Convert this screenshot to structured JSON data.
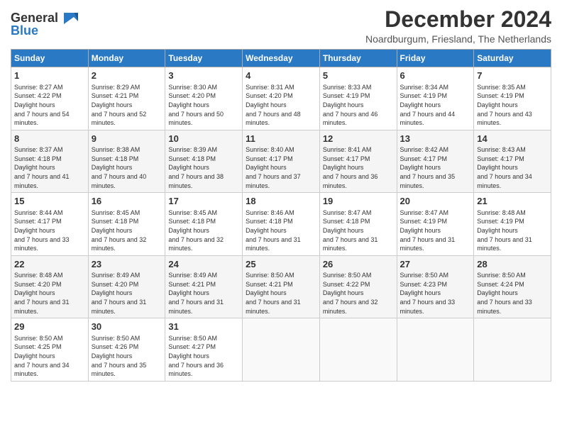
{
  "header": {
    "logo_line1": "General",
    "logo_line2": "Blue",
    "month": "December 2024",
    "location": "Noardburgum, Friesland, The Netherlands"
  },
  "days_of_week": [
    "Sunday",
    "Monday",
    "Tuesday",
    "Wednesday",
    "Thursday",
    "Friday",
    "Saturday"
  ],
  "weeks": [
    [
      {
        "day": "1",
        "sunrise": "8:27 AM",
        "sunset": "4:22 PM",
        "daylight": "7 hours and 54 minutes."
      },
      {
        "day": "2",
        "sunrise": "8:29 AM",
        "sunset": "4:21 PM",
        "daylight": "7 hours and 52 minutes."
      },
      {
        "day": "3",
        "sunrise": "8:30 AM",
        "sunset": "4:20 PM",
        "daylight": "7 hours and 50 minutes."
      },
      {
        "day": "4",
        "sunrise": "8:31 AM",
        "sunset": "4:20 PM",
        "daylight": "7 hours and 48 minutes."
      },
      {
        "day": "5",
        "sunrise": "8:33 AM",
        "sunset": "4:19 PM",
        "daylight": "7 hours and 46 minutes."
      },
      {
        "day": "6",
        "sunrise": "8:34 AM",
        "sunset": "4:19 PM",
        "daylight": "7 hours and 44 minutes."
      },
      {
        "day": "7",
        "sunrise": "8:35 AM",
        "sunset": "4:19 PM",
        "daylight": "7 hours and 43 minutes."
      }
    ],
    [
      {
        "day": "8",
        "sunrise": "8:37 AM",
        "sunset": "4:18 PM",
        "daylight": "7 hours and 41 minutes."
      },
      {
        "day": "9",
        "sunrise": "8:38 AM",
        "sunset": "4:18 PM",
        "daylight": "7 hours and 40 minutes."
      },
      {
        "day": "10",
        "sunrise": "8:39 AM",
        "sunset": "4:18 PM",
        "daylight": "7 hours and 38 minutes."
      },
      {
        "day": "11",
        "sunrise": "8:40 AM",
        "sunset": "4:17 PM",
        "daylight": "7 hours and 37 minutes."
      },
      {
        "day": "12",
        "sunrise": "8:41 AM",
        "sunset": "4:17 PM",
        "daylight": "7 hours and 36 minutes."
      },
      {
        "day": "13",
        "sunrise": "8:42 AM",
        "sunset": "4:17 PM",
        "daylight": "7 hours and 35 minutes."
      },
      {
        "day": "14",
        "sunrise": "8:43 AM",
        "sunset": "4:17 PM",
        "daylight": "7 hours and 34 minutes."
      }
    ],
    [
      {
        "day": "15",
        "sunrise": "8:44 AM",
        "sunset": "4:17 PM",
        "daylight": "7 hours and 33 minutes."
      },
      {
        "day": "16",
        "sunrise": "8:45 AM",
        "sunset": "4:18 PM",
        "daylight": "7 hours and 32 minutes."
      },
      {
        "day": "17",
        "sunrise": "8:45 AM",
        "sunset": "4:18 PM",
        "daylight": "7 hours and 32 minutes."
      },
      {
        "day": "18",
        "sunrise": "8:46 AM",
        "sunset": "4:18 PM",
        "daylight": "7 hours and 31 minutes."
      },
      {
        "day": "19",
        "sunrise": "8:47 AM",
        "sunset": "4:18 PM",
        "daylight": "7 hours and 31 minutes."
      },
      {
        "day": "20",
        "sunrise": "8:47 AM",
        "sunset": "4:19 PM",
        "daylight": "7 hours and 31 minutes."
      },
      {
        "day": "21",
        "sunrise": "8:48 AM",
        "sunset": "4:19 PM",
        "daylight": "7 hours and 31 minutes."
      }
    ],
    [
      {
        "day": "22",
        "sunrise": "8:48 AM",
        "sunset": "4:20 PM",
        "daylight": "7 hours and 31 minutes."
      },
      {
        "day": "23",
        "sunrise": "8:49 AM",
        "sunset": "4:20 PM",
        "daylight": "7 hours and 31 minutes."
      },
      {
        "day": "24",
        "sunrise": "8:49 AM",
        "sunset": "4:21 PM",
        "daylight": "7 hours and 31 minutes."
      },
      {
        "day": "25",
        "sunrise": "8:50 AM",
        "sunset": "4:21 PM",
        "daylight": "7 hours and 31 minutes."
      },
      {
        "day": "26",
        "sunrise": "8:50 AM",
        "sunset": "4:22 PM",
        "daylight": "7 hours and 32 minutes."
      },
      {
        "day": "27",
        "sunrise": "8:50 AM",
        "sunset": "4:23 PM",
        "daylight": "7 hours and 33 minutes."
      },
      {
        "day": "28",
        "sunrise": "8:50 AM",
        "sunset": "4:24 PM",
        "daylight": "7 hours and 33 minutes."
      }
    ],
    [
      {
        "day": "29",
        "sunrise": "8:50 AM",
        "sunset": "4:25 PM",
        "daylight": "7 hours and 34 minutes."
      },
      {
        "day": "30",
        "sunrise": "8:50 AM",
        "sunset": "4:26 PM",
        "daylight": "7 hours and 35 minutes."
      },
      {
        "day": "31",
        "sunrise": "8:50 AM",
        "sunset": "4:27 PM",
        "daylight": "7 hours and 36 minutes."
      },
      null,
      null,
      null,
      null
    ]
  ]
}
